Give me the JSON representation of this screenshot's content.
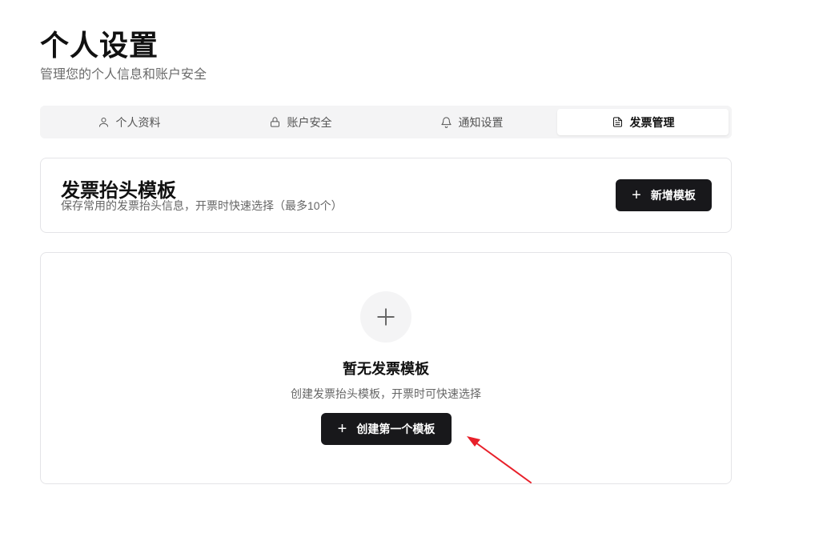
{
  "page": {
    "title": "个人设置",
    "subtitle": "管理您的个人信息和账户安全"
  },
  "tabs": [
    {
      "label": "个人资料",
      "icon": "user-icon",
      "active": false
    },
    {
      "label": "账户安全",
      "icon": "lock-icon",
      "active": false
    },
    {
      "label": "通知设置",
      "icon": "bell-icon",
      "active": false
    },
    {
      "label": "发票管理",
      "icon": "file-text-icon",
      "active": true
    }
  ],
  "header_card": {
    "title": "发票抬头模板",
    "description": "保存常用的发票抬头信息，开票时快速选择（最多10个）",
    "add_button": {
      "icon": "+",
      "label": "新增模板"
    }
  },
  "empty_state": {
    "icon": "plus-icon",
    "title": "暂无发票模板",
    "description": "创建发票抬头模板，开票时可快速选择",
    "create_button": {
      "icon": "+",
      "label": "创建第一个模板"
    }
  },
  "colors": {
    "primary_button": "#18181b",
    "tab_bar": "#f4f4f5",
    "annotation_arrow": "#e8202a"
  }
}
